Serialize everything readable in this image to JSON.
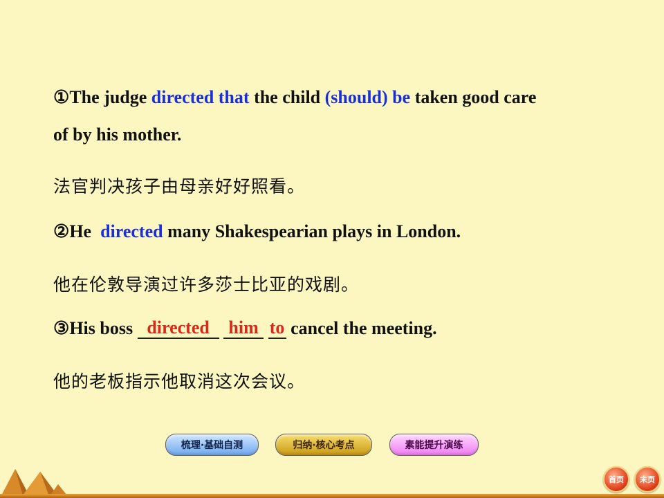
{
  "sentences": {
    "s1": {
      "marker": "①",
      "part1": "The judge ",
      "hl1": "directed that",
      "part2": " the child ",
      "hl2": "(should) be",
      "part3": " taken good care",
      "cont": "of by his mother.",
      "translation": "法官判决孩子由母亲好好照看。"
    },
    "s2": {
      "marker": "②",
      "part1": "He  ",
      "hl1": "directed",
      "part2": " many Shakespearian plays in London.",
      "translation": "他在伦敦导演过许多莎士比亚的戏剧。"
    },
    "s3": {
      "marker": "③",
      "part1": "His boss ",
      "blank1": "directed",
      "blank2": "him",
      "blank3": "to",
      "part2": " cancel the meeting.",
      "translation": "他的老板指示他取消这次会议。"
    }
  },
  "nav": {
    "btn1": "梳理·基础自测",
    "btn2": "归纳·核心考点",
    "btn3": "素能提升演练",
    "first": "首页",
    "last": "末页"
  },
  "colors": {
    "background": "#fcf7c0",
    "highlight_blue": "#1b2fd6",
    "answer_red": "#d62a1c"
  }
}
